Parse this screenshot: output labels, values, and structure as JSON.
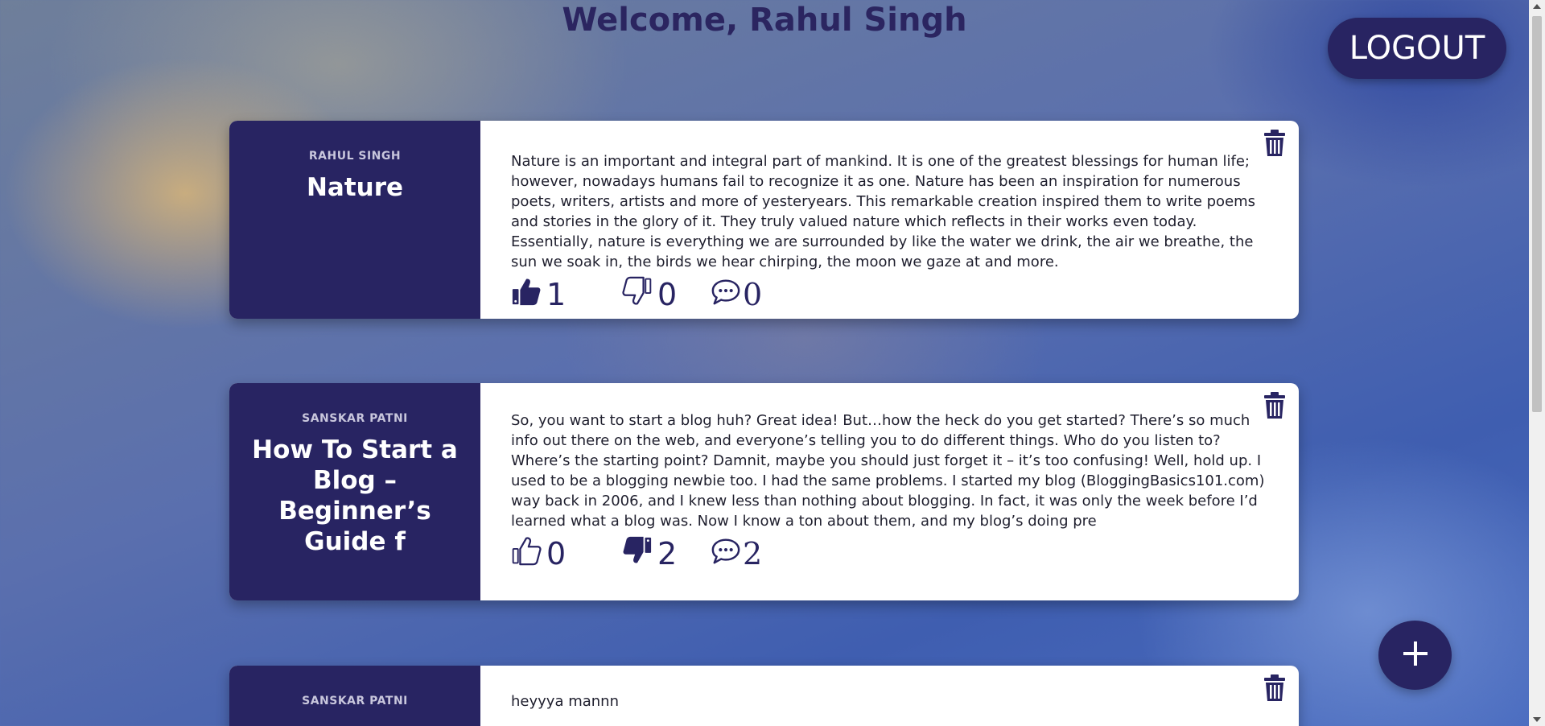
{
  "header": {
    "title": "Welcome, Rahul Singh",
    "logout_label": "LOGOUT"
  },
  "posts": [
    {
      "author": "RAHUL SINGH",
      "title": "Nature",
      "body": "Nature is an important and integral part of mankind. It is one of the greatest blessings for human life; however, nowadays humans fail to recognize it as one. Nature has been an inspiration for numerous poets, writers, artists and more of yesteryears. This remarkable creation inspired them to write poems and stories in the glory of it. They truly valued nature which reflects in their works even today. Essentially, nature is everything we are surrounded by like the water we drink, the air we breathe, the sun we soak in, the birds we hear chirping, the moon we gaze at and more.",
      "likes": "1",
      "dislikes": "0",
      "comments": "0",
      "liked": true,
      "disliked": false
    },
    {
      "author": "SANSKAR PATNI",
      "title": "How To Start a Blog – Beginner’s Guide f",
      "body": "So, you want to start a blog huh? Great idea! But…how the heck do you get started? There’s so much info out there on the web, and everyone’s telling you to do different things. Who do you listen to? Where’s the starting point? Damnit, maybe you should just forget it – it’s too confusing! Well, hold up. I used to be a blogging newbie too. I had the same problems. I started my blog (BloggingBasics101.com) way back in 2006, and I knew less than nothing about blogging. In fact, it was only the week before I’d learned what a blog was. Now I know a ton about them, and my blog’s doing pre",
      "likes": "0",
      "dislikes": "2",
      "comments": "2",
      "liked": false,
      "disliked": true
    },
    {
      "author": "SANSKAR PATNI",
      "title": "",
      "body": "heyyya mannn",
      "likes": "",
      "dislikes": "",
      "comments": "",
      "liked": false,
      "disliked": false
    }
  ],
  "colors": {
    "primary": "#282462",
    "title": "#2b2560",
    "card": "#ffffff"
  },
  "icons": {
    "delete": "trash-icon",
    "like": "thumbs-up-icon",
    "dislike": "thumbs-down-icon",
    "comment": "comment-icon",
    "add": "plus-icon"
  }
}
